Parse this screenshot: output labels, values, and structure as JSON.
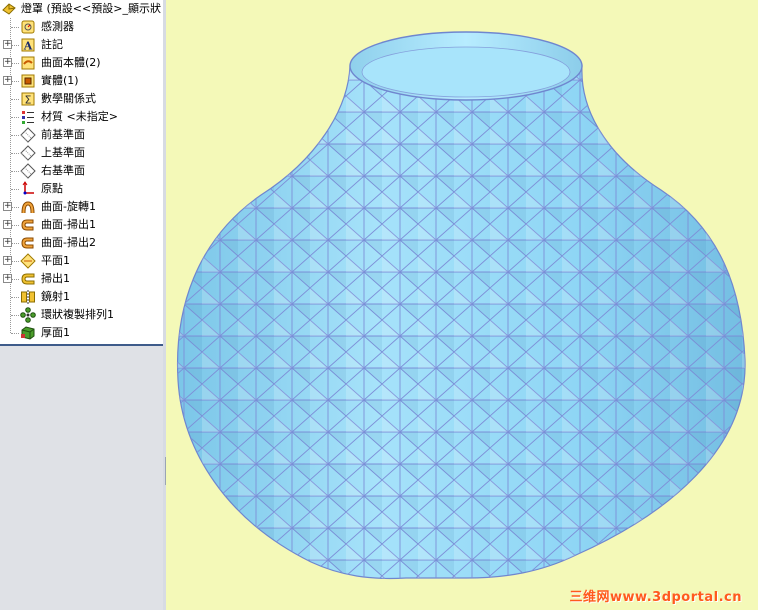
{
  "tree": {
    "root_label": "燈罩 (預設<<預設>_顯示狀",
    "items": [
      {
        "label": "感測器",
        "icon": "sensor-icon",
        "expandable": false
      },
      {
        "label": "註記",
        "icon": "annotation-icon",
        "expandable": true
      },
      {
        "label": "曲面本體(2)",
        "icon": "surface-bodies-icon",
        "expandable": true
      },
      {
        "label": "實體(1)",
        "icon": "solid-bodies-icon",
        "expandable": true
      },
      {
        "label": "數學關係式",
        "icon": "equations-icon",
        "expandable": false
      },
      {
        "label": "材質 <未指定>",
        "icon": "material-icon",
        "expandable": false
      },
      {
        "label": "前基準面",
        "icon": "plane-icon",
        "expandable": false
      },
      {
        "label": "上基準面",
        "icon": "plane-icon",
        "expandable": false
      },
      {
        "label": "右基準面",
        "icon": "plane-icon",
        "expandable": false
      },
      {
        "label": "原點",
        "icon": "origin-icon",
        "expandable": false
      },
      {
        "label": "曲面-旋轉1",
        "icon": "surface-revolve-icon",
        "expandable": true
      },
      {
        "label": "曲面-掃出1",
        "icon": "surface-sweep-icon",
        "expandable": true
      },
      {
        "label": "曲面-掃出2",
        "icon": "surface-sweep-icon",
        "expandable": true
      },
      {
        "label": "平面1",
        "icon": "plane-feature-icon",
        "expandable": true
      },
      {
        "label": "掃出1",
        "icon": "sweep-icon",
        "expandable": true
      },
      {
        "label": "鏡射1",
        "icon": "mirror-icon",
        "expandable": false
      },
      {
        "label": "環狀複製排列1",
        "icon": "circular-pattern-icon",
        "expandable": false
      },
      {
        "label": "厚面1",
        "icon": "thicken-icon",
        "expandable": false
      }
    ]
  },
  "viewport": {
    "model_color": "#8fd6f5",
    "edge_color": "#7d8fd8",
    "background": "#f4f9b8"
  },
  "watermark": "三维网www.3dportal.cn"
}
